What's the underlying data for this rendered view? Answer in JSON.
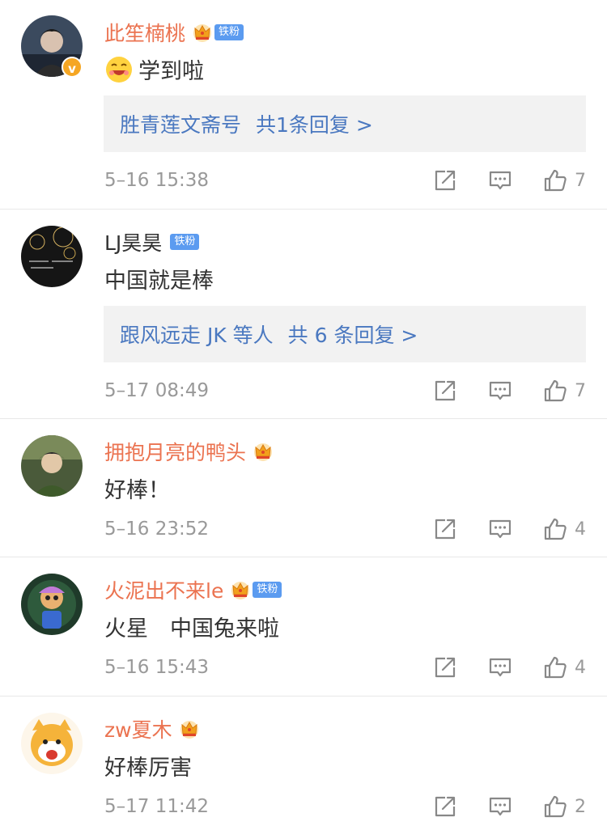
{
  "comments": [
    {
      "username": "此笙楠桃",
      "fan_badge": "铁粉",
      "text": "学到啦",
      "reply_summary": {
        "who": "胜青莲文斋号",
        "count_text": "共1条回复 >"
      },
      "time": "5–16 15:38",
      "likes": "7"
    },
    {
      "username": "LJ昊昊",
      "fan_badge": "铁粉",
      "text": "中国就是棒",
      "reply_summary": {
        "who": "跟风远走 JK 等人",
        "count_text": "共 6 条回复 >"
      },
      "time": "5–17 08:49",
      "likes": "7"
    },
    {
      "username": "拥抱月亮的鸭头",
      "text": "好棒！",
      "time": "5–16 23:52",
      "likes": "4"
    },
    {
      "username": "火泥出不来le",
      "fan_badge": "铁粉",
      "text": "火星　中国兔来啦",
      "time": "5–16 15:43",
      "likes": "4"
    },
    {
      "username": "zw夏木",
      "text": "好棒厉害",
      "time": "5–17 11:42",
      "likes": "2"
    }
  ],
  "icons": {
    "share": "share-icon",
    "comment": "comment-icon",
    "like": "thumbs-up-icon",
    "crown": "crown-icon"
  },
  "colors": {
    "username": "#eb7350",
    "link": "#4a78c0",
    "fan_badge": "#5b9bf0",
    "meta": "#999999"
  }
}
